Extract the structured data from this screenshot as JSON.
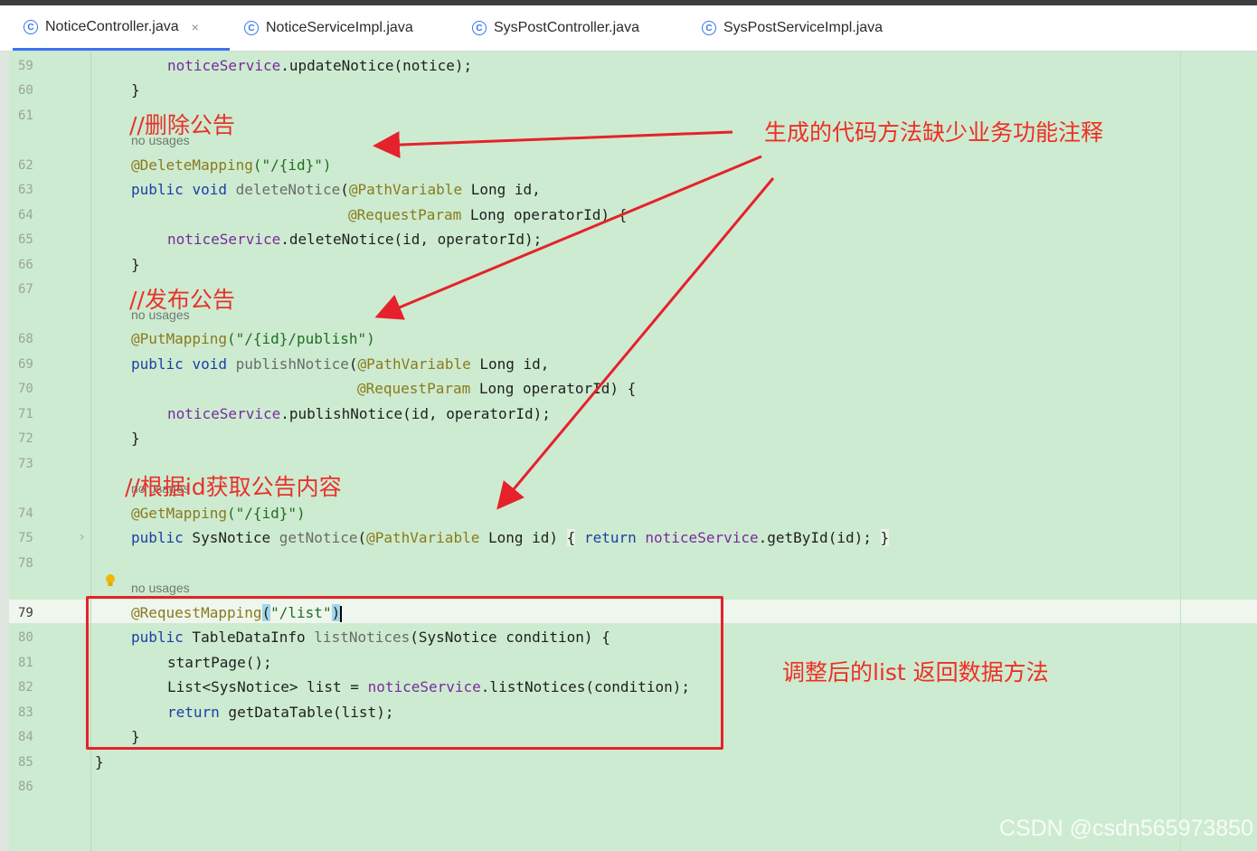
{
  "tabs": [
    {
      "label": "NoticeController.java",
      "active": true,
      "close": "×",
      "icon": "class-icon"
    },
    {
      "label": "NoticeServiceImpl.java",
      "active": false,
      "icon": "class-icon"
    },
    {
      "label": "SysPostController.java",
      "active": false,
      "icon": "class-icon"
    },
    {
      "label": "SysPostServiceImpl.java",
      "active": false,
      "icon": "class-icon"
    }
  ],
  "lines": {
    "n59": "59",
    "n60": "60",
    "n61": "61",
    "n62": "62",
    "n63": "63",
    "n64": "64",
    "n65": "65",
    "n66": "66",
    "n67": "67",
    "n68": "68",
    "n69": "69",
    "n70": "70",
    "n71": "71",
    "n72": "72",
    "n73": "73",
    "n74": "74",
    "n75": "75",
    "n78": "78",
    "n79": "79",
    "n80": "80",
    "n81": "81",
    "n82": "82",
    "n83": "83",
    "n84": "84",
    "n85": "85",
    "n86": "86"
  },
  "code": {
    "l59_field": "noticeService",
    "l59_rest": ".updateNotice(notice);",
    "brace_close": "}",
    "l62_ann": "@DeleteMapping",
    "l62_str": "(\"/{id}\")",
    "kw_public": "public",
    "kw_void": "void",
    "l63_method": "deleteNotice",
    "l63_paren": "(",
    "pathvar": "@PathVariable",
    "long_id": " Long id,",
    "reqparam": "@RequestParam",
    "long_opid": " Long operatorId) {",
    "l65_rest": ".deleteNotice(id, operatorId);",
    "l68_ann": "@PutMapping",
    "l68_str": "(\"/{id}/publish\")",
    "l69_method": "publishNotice",
    "l71_rest": ".publishNotice(id, operatorId);",
    "l74_ann": "@GetMapping",
    "l74_str": "(\"/{id}\")",
    "l75_type": " SysNotice ",
    "l75_method": "getNotice",
    "long_id_close": " Long id) ",
    "l75_open": "{",
    "kw_return": "return",
    "l75_rest": ".getById(id);",
    "l75_close": "}",
    "l79_ann": "@RequestMapping",
    "l79_p1": "(",
    "l79_str": "\"/list\"",
    "l79_p2": ")",
    "l80_type": " TableDataInfo ",
    "l80_method": "listNotices",
    "l80_rest": "(SysNotice condition) {",
    "l81": "startPage();",
    "l82_a": "List<SysNotice> list = ",
    "l82_b": ".listNotices(condition);",
    "l83_rest": " getDataTable(list);"
  },
  "no_usages": "no usages",
  "comments": {
    "delete": "//删除公告",
    "publish": "//发布公告",
    "get": "//根据id获取公告内容"
  },
  "notes": {
    "missing": "生成的代码方法缺少业务功能注释",
    "adjusted": "调整后的list 返回数据方法"
  },
  "colors": {
    "arrow": "#e5222b",
    "editor_bg": "#cdebd0",
    "keyword": "#1b3fa6"
  },
  "watermark": "CSDN @csdn565973850"
}
